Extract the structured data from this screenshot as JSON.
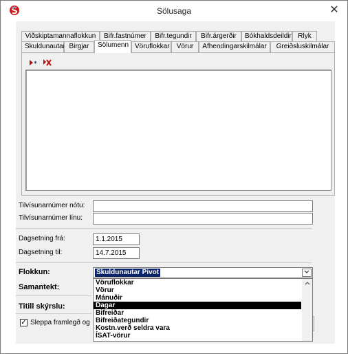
{
  "window": {
    "title": "Sölusaga",
    "close_glyph": "✕"
  },
  "tabs": {
    "row1": [
      {
        "label": "Viðskiptamannaflokkun"
      },
      {
        "label": "Bifr.fastnúmer"
      },
      {
        "label": "Bifr.tegundir"
      },
      {
        "label": "Bifr.árgerðir"
      },
      {
        "label": "Bókhaldsdeildir"
      },
      {
        "label": "Rlyk"
      }
    ],
    "row2": [
      {
        "label": "Skuldunautar"
      },
      {
        "label": "Birgjar"
      },
      {
        "label": "Sölumenn",
        "active": true
      },
      {
        "label": "Vöruflokkar"
      },
      {
        "label": "Vörur"
      },
      {
        "label": "Afhendingarskilmálar"
      },
      {
        "label": "Greiðsluskilmálar"
      }
    ]
  },
  "toolbar": {
    "add_icon": "add-record-icon",
    "remove_icon": "remove-record-icon"
  },
  "form": {
    "invoice_ref_label": "Tilvísunarnúmer nótu:",
    "invoice_ref_value": "",
    "line_ref_label": "Tilvísunarnúmer línu:",
    "line_ref_value": "",
    "date_from_label": "Dagsetning frá:",
    "date_from_value": "1.1.2015",
    "date_to_label": "Dagsetning til:",
    "date_to_value": "14.7.2015",
    "category_label": "Flokkun:",
    "category_value": "Skuldunautar Pivot",
    "summary_label": "Samantekt:",
    "report_title_label": "Titill skýrslu:",
    "checkbox_label": "Sleppa framlegð og",
    "checkbox_checked": true
  },
  "dropdown": {
    "options": [
      "Vöruflokkar",
      "Vörur",
      "Mánuðir",
      "Dagar",
      "Bifreiðar",
      "Bifreiðategundir",
      "Kostn.verð seldra vara",
      "ÍSAT-vörur"
    ],
    "selected": "Dagar"
  },
  "colors": {
    "accent": "#0a246a",
    "selection": "#000000",
    "app_icon_red": "#cc1a1a",
    "app_icon_blue": "#1a3a8a"
  }
}
